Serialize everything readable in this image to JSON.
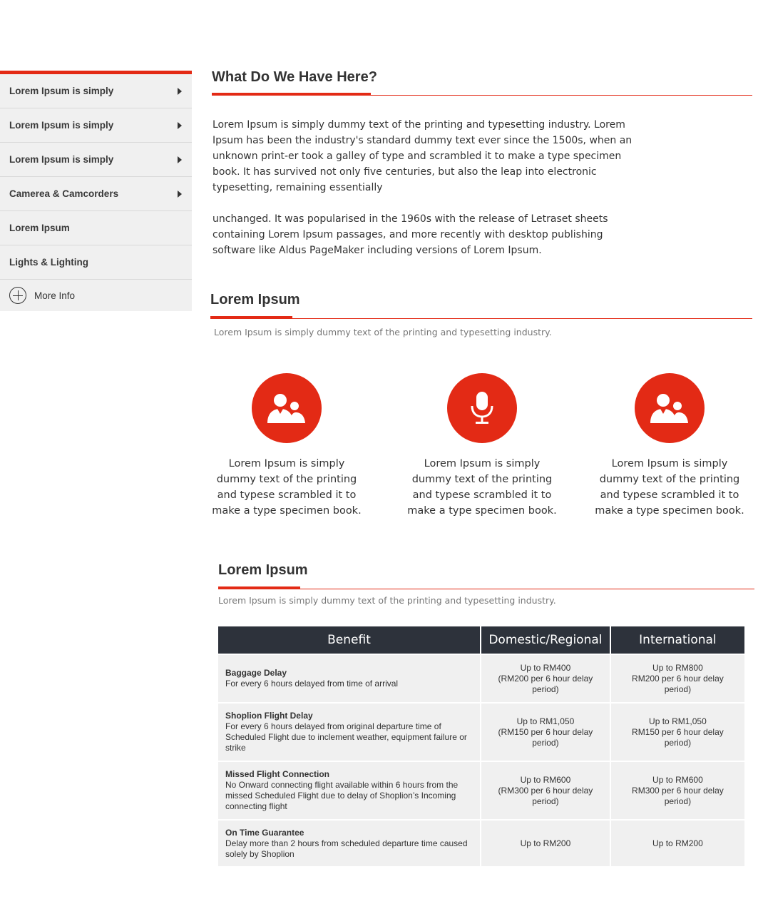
{
  "sidebar": {
    "items": [
      {
        "label": "Lorem Ipsum is simply",
        "has_arrow": true
      },
      {
        "label": "Lorem Ipsum is simply",
        "has_arrow": true
      },
      {
        "label": "Lorem Ipsum is simply",
        "has_arrow": true
      },
      {
        "label": "Camerea & Camcorders",
        "has_arrow": true
      },
      {
        "label": "Lorem Ipsum",
        "has_arrow": false
      },
      {
        "label": "Lights & Lighting",
        "has_arrow": false
      }
    ],
    "more_info": "More Info"
  },
  "section1": {
    "title": "What Do We Have Here?",
    "para1": "Lorem Ipsum is simply dummy text of the printing and typesetting industry. Lorem Ipsum has been the industry's standard dummy text ever since the 1500s, when an unknown print-er took a galley of type and scrambled it to make a type specimen book. It has survived not only five centuries, but also the leap into electronic typesetting, remaining essentially",
    "para2": "unchanged. It was popularised in the 1960s with the release of Letraset sheets containing Lorem Ipsum passages, and more recently with desktop publishing software like Aldus PageMaker including versions of Lorem Ipsum."
  },
  "section2": {
    "title": "Lorem Ipsum",
    "subtitle": "Lorem Ipsum is simply dummy text of the printing and typesetting industry.",
    "features": [
      {
        "icon": "users-icon",
        "text": "Lorem Ipsum is simply dummy text of the printing and typese scrambled it to make a type specimen book."
      },
      {
        "icon": "microphone-icon",
        "text": "Lorem Ipsum is simply dummy text of the printing and typese scrambled it to make a type specimen book."
      },
      {
        "icon": "users-icon",
        "text": "Lorem Ipsum is simply dummy text of the printing and typese scrambled it to make a type specimen book."
      }
    ]
  },
  "section3": {
    "title": "Lorem Ipsum",
    "subtitle": "Lorem Ipsum is simply dummy text of the printing and typesetting industry.",
    "table": {
      "headers": [
        "Benefit",
        "Domestic/Regional",
        "International"
      ],
      "rows": [
        {
          "title": "Baggage Delay",
          "desc": "For every 6 hours delayed from time of arrival",
          "domestic": "Up to RM400\n(RM200 per 6 hour delay period)",
          "international": "Up to RM800\nRM200 per 6 hour delay period)"
        },
        {
          "title": "Shoplion Flight Delay",
          "desc": "For every 6 hours delayed from original departure time of Scheduled Flight due to inclement weather, equipment failure or strike",
          "domestic": "Up to RM1,050\n(RM150 per 6 hour delay period)",
          "international": "Up to RM1,050\nRM150 per 6 hour delay period)"
        },
        {
          "title": "Missed Flight Connection",
          "desc": "No Onward connecting flight available within 6 hours from the missed Scheduled Flight due to delay of Shoplion’s Incoming connecting flight",
          "domestic": "Up to RM600\n(RM300 per 6 hour delay period)",
          "international": "Up to RM600\nRM300 per 6 hour delay period)"
        },
        {
          "title": "On Time Guarantee",
          "desc": "Delay more than 2 hours from scheduled departure time caused solely by Shoplion",
          "domestic": "Up to RM200",
          "international": "Up to RM200"
        }
      ]
    }
  },
  "colors": {
    "accent": "#e32a15",
    "header_bg": "#2d323b",
    "sidebar_bg": "#f0f0f0"
  }
}
